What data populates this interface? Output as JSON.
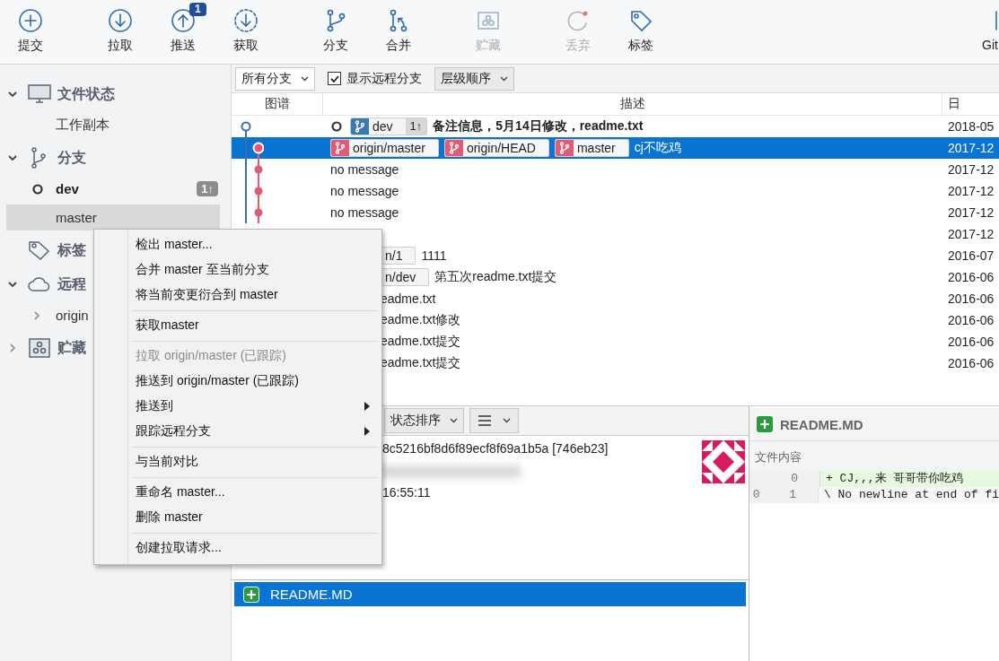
{
  "toolbar": {
    "buttons": [
      {
        "kind": "commit",
        "label": "提交",
        "disabled": false
      },
      {
        "kind": "pull",
        "label": "拉取",
        "disabled": false
      },
      {
        "kind": "push",
        "label": "推送",
        "disabled": false,
        "badge": "1"
      },
      {
        "kind": "fetch",
        "label": "获取",
        "disabled": false
      },
      {
        "kind": "branch",
        "label": "分支",
        "disabled": false
      },
      {
        "kind": "merge",
        "label": "合并",
        "disabled": false
      },
      {
        "kind": "stash",
        "label": "贮藏",
        "disabled": true
      },
      {
        "kind": "discard",
        "label": "丢弃",
        "disabled": true
      },
      {
        "kind": "tag",
        "label": "标签",
        "disabled": false
      },
      {
        "kind": "git",
        "label": "Git",
        "disabled": false
      }
    ]
  },
  "sidebar": {
    "sections": [
      {
        "kind": "workspace",
        "label": "文件状态",
        "expanded": true,
        "items": [
          {
            "label": "工作副本",
            "selected": false,
            "current": false
          }
        ]
      },
      {
        "kind": "branches",
        "label": "分支",
        "expanded": true,
        "items": [
          {
            "label": "dev",
            "selected": false,
            "current": true,
            "badge": "1↑"
          },
          {
            "label": "master",
            "selected": true,
            "current": false
          }
        ]
      },
      {
        "kind": "tags",
        "label": "标签"
      },
      {
        "kind": "remotes",
        "label": "远程",
        "expanded": true,
        "items": [
          {
            "label": "origin",
            "selected": false,
            "current": false,
            "expanded": false
          }
        ]
      },
      {
        "kind": "stashes",
        "label": "贮藏",
        "expanded": false
      }
    ]
  },
  "filters": {
    "branches": "所有分支",
    "show_remote": {
      "label": "显示远程分支",
      "checked": true
    },
    "order": "层级顺序"
  },
  "commits": {
    "columns": [
      "图谱",
      "描述",
      "日"
    ],
    "rows": [
      {
        "selected": false,
        "head": true,
        "tags": [
          {
            "kind": "branch",
            "label": "dev",
            "color": "#3a77b5",
            "ahead": "1↑"
          }
        ],
        "description": "备注信息，5月14日修改，readme.txt",
        "date": "2018-05"
      },
      {
        "selected": true,
        "head": false,
        "tags": [
          {
            "kind": "branch",
            "label": "origin/master",
            "color": "#e45a72"
          },
          {
            "kind": "branch",
            "label": "origin/HEAD",
            "color": "#e45a72"
          },
          {
            "kind": "branch",
            "label": "master",
            "color": "#e45a72"
          }
        ],
        "description": "cj不吃鸡",
        "date": "2017-12"
      },
      {
        "selected": false,
        "head": false,
        "description": "no message",
        "date": "2017-12"
      },
      {
        "selected": false,
        "head": false,
        "description": "no message",
        "date": "2017-12"
      },
      {
        "selected": false,
        "head": false,
        "description": "no message",
        "date": "2017-12"
      },
      {
        "selected": false,
        "head": false,
        "date": "2017-12"
      },
      {
        "selected": false,
        "head": false,
        "tags": [
          {
            "kind": "clipped",
            "label": "n/1"
          }
        ],
        "description": "1111",
        "date": "2016-07"
      },
      {
        "selected": false,
        "head": false,
        "tags": [
          {
            "kind": "clipped",
            "label": "n/dev"
          }
        ],
        "description": "第五次readme.txt提交",
        "date": "2016-06"
      },
      {
        "selected": false,
        "head": false,
        "description": "eadme.txt",
        "date": "2016-06"
      },
      {
        "selected": false,
        "head": false,
        "description": "eadme.txt修改",
        "date": "2016-06"
      },
      {
        "selected": false,
        "head": false,
        "description": "eadme.txt提交",
        "date": "2016-06"
      },
      {
        "selected": false,
        "head": false,
        "description": "eadme.txt提交",
        "date": "2016-06"
      }
    ]
  },
  "context_menu": {
    "items": [
      {
        "kind": "item",
        "label": "检出 master...",
        "disabled": false,
        "submenu": false
      },
      {
        "kind": "item",
        "label": "合并 master 至当前分支",
        "disabled": false,
        "submenu": false
      },
      {
        "kind": "item",
        "label": "将当前变更衍合到 master",
        "disabled": false,
        "submenu": false
      },
      {
        "kind": "separator"
      },
      {
        "kind": "item",
        "label": "获取master",
        "disabled": false,
        "submenu": false
      },
      {
        "kind": "separator"
      },
      {
        "kind": "item",
        "label": "拉取 origin/master (已跟踪)",
        "disabled": true,
        "submenu": false
      },
      {
        "kind": "item",
        "label": "推送到 origin/master (已跟踪)",
        "disabled": false,
        "submenu": false
      },
      {
        "kind": "item",
        "label": "推送到",
        "disabled": false,
        "submenu": true
      },
      {
        "kind": "item",
        "label": "跟踪远程分支",
        "disabled": false,
        "submenu": true
      },
      {
        "kind": "separator"
      },
      {
        "kind": "item",
        "label": "与当前对比",
        "disabled": false,
        "submenu": false
      },
      {
        "kind": "separator"
      },
      {
        "kind": "item",
        "label": "重命名 master...",
        "disabled": false,
        "submenu": false
      },
      {
        "kind": "item",
        "label": "删除 master",
        "disabled": false,
        "submenu": false
      },
      {
        "kind": "separator"
      },
      {
        "kind": "item",
        "label": "创建拉取请求...",
        "disabled": false,
        "submenu": false
      }
    ]
  },
  "details": {
    "sort": "状态排序",
    "hash": "8c5216bf8d6f89ecf8f69a1b5a [746eb23]",
    "time": "16:55:11",
    "files": [
      {
        "name": "README.MD",
        "added": true,
        "selected": true
      }
    ]
  },
  "diff": {
    "file": "README.MD",
    "added": true,
    "section": "文件内容",
    "lines": [
      {
        "kind": "added",
        "new": "0",
        "text": "+ CJ,,,来   哥哥带你吃鸡"
      },
      {
        "kind": "context",
        "old": "0",
        "new": "1",
        "text": "\\  No newline at end of fi"
      }
    ]
  }
}
